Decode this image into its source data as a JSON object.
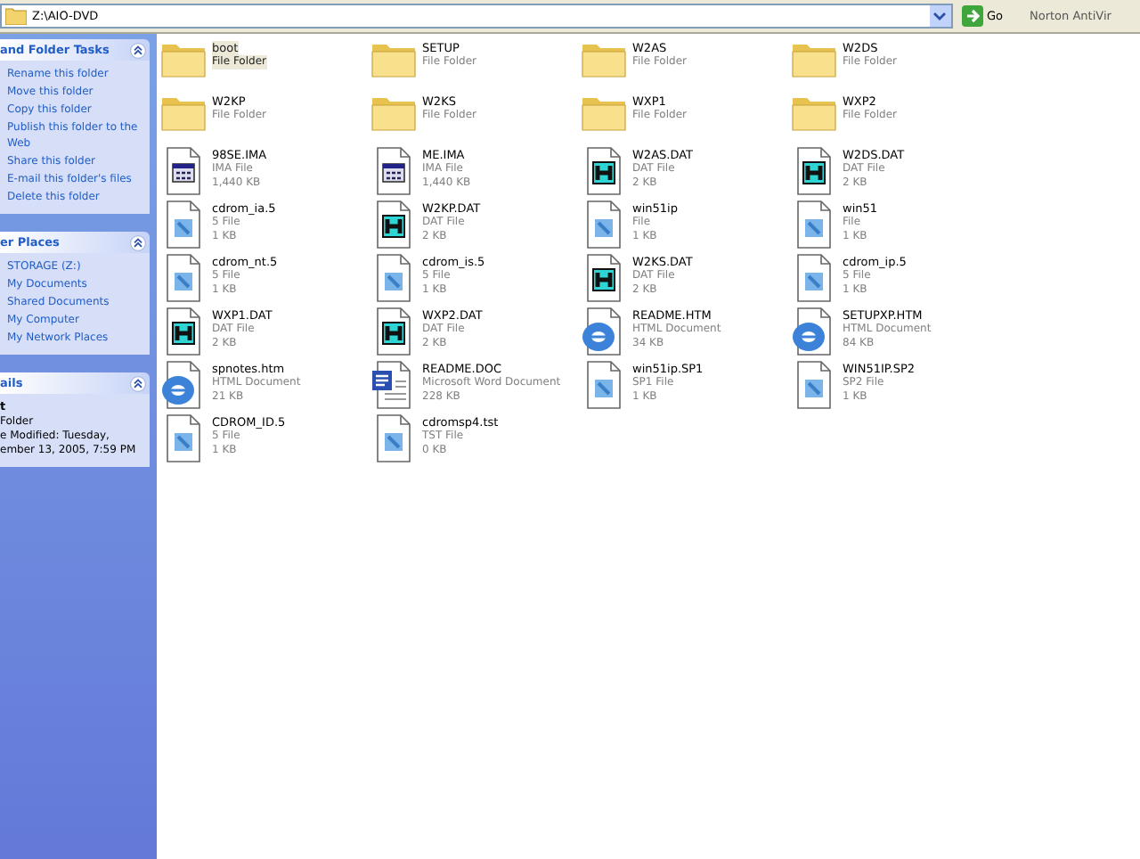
{
  "address_bar": {
    "path": "Z:\\AIO-DVD",
    "go_label": "Go",
    "toolbar_text": "Norton AntiVir"
  },
  "sidebar": {
    "panels": [
      {
        "kind": "links",
        "title": "and Folder Tasks",
        "expanded": true,
        "items": [
          "Rename this folder",
          "Move this folder",
          "Copy this folder",
          "Publish this folder to the Web",
          "Share this folder",
          "E-mail this folder's files",
          "Delete this folder"
        ]
      },
      {
        "kind": "links",
        "title": "er Places",
        "expanded": true,
        "items": [
          "STORAGE (Z:)",
          "My Documents",
          "Shared Documents",
          "My Computer",
          "My Network Places"
        ]
      },
      {
        "kind": "details",
        "title": "ails",
        "expanded": true,
        "name": "t",
        "type": "Folder",
        "modified": [
          "e Modified: Tuesday,",
          "ember 13, 2005, 7:59 PM"
        ]
      }
    ]
  },
  "files": [
    {
      "kind": "folder",
      "name": "boot",
      "type": "File Folder",
      "selected": true
    },
    {
      "kind": "folder",
      "name": "SETUP",
      "type": "File Folder",
      "selected": false
    },
    {
      "kind": "folder",
      "name": "W2AS",
      "type": "File Folder",
      "selected": false
    },
    {
      "kind": "folder",
      "name": "W2DS",
      "type": "File Folder",
      "selected": false
    },
    {
      "kind": "folder",
      "name": "W2KP",
      "type": "File Folder",
      "selected": false
    },
    {
      "kind": "folder",
      "name": "W2KS",
      "type": "File Folder",
      "selected": false
    },
    {
      "kind": "folder",
      "name": "WXP1",
      "type": "File Folder",
      "selected": false
    },
    {
      "kind": "folder",
      "name": "WXP2",
      "type": "File Folder",
      "selected": false
    },
    {
      "kind": "image",
      "name": "98SE.IMA",
      "type": "IMA File",
      "size": "1,440 KB",
      "selected": false
    },
    {
      "kind": "image",
      "name": "ME.IMA",
      "type": "IMA File",
      "size": "1,440 KB",
      "selected": false
    },
    {
      "kind": "dat",
      "name": "W2AS.DAT",
      "type": "DAT File",
      "size": "2 KB",
      "selected": false
    },
    {
      "kind": "dat",
      "name": "W2DS.DAT",
      "type": "DAT File",
      "size": "2 KB",
      "selected": false
    },
    {
      "kind": "generic",
      "name": "cdrom_ia.5",
      "type": "5 File",
      "size": "1 KB",
      "selected": false
    },
    {
      "kind": "dat",
      "name": "W2KP.DAT",
      "type": "DAT File",
      "size": "2 KB",
      "selected": false
    },
    {
      "kind": "generic",
      "name": "win51ip",
      "type": "File",
      "size": "1 KB",
      "selected": false
    },
    {
      "kind": "generic",
      "name": "win51",
      "type": "File",
      "size": "1 KB",
      "selected": false
    },
    {
      "kind": "generic",
      "name": "cdrom_nt.5",
      "type": "5 File",
      "size": "1 KB",
      "selected": false
    },
    {
      "kind": "generic",
      "name": "cdrom_is.5",
      "type": "5 File",
      "size": "1 KB",
      "selected": false
    },
    {
      "kind": "dat",
      "name": "W2KS.DAT",
      "type": "DAT File",
      "size": "2 KB",
      "selected": false
    },
    {
      "kind": "generic",
      "name": "cdrom_ip.5",
      "type": "5 File",
      "size": "1 KB",
      "selected": false
    },
    {
      "kind": "dat",
      "name": "WXP1.DAT",
      "type": "DAT File",
      "size": "2 KB",
      "selected": false
    },
    {
      "kind": "dat",
      "name": "WXP2.DAT",
      "type": "DAT File",
      "size": "2 KB",
      "selected": false
    },
    {
      "kind": "html",
      "name": "README.HTM",
      "type": "HTML Document",
      "size": "34 KB",
      "selected": false
    },
    {
      "kind": "html",
      "name": "SETUPXP.HTM",
      "type": "HTML Document",
      "size": "84 KB",
      "selected": false
    },
    {
      "kind": "html",
      "name": "spnotes.htm",
      "type": "HTML Document",
      "size": "21 KB",
      "selected": false
    },
    {
      "kind": "word",
      "name": "README.DOC",
      "type": "Microsoft Word Document",
      "size": "228 KB",
      "selected": false
    },
    {
      "kind": "generic",
      "name": "win51ip.SP1",
      "type": "SP1 File",
      "size": "1 KB",
      "selected": false
    },
    {
      "kind": "generic",
      "name": "WIN51IP.SP2",
      "type": "SP2 File",
      "size": "1 KB",
      "selected": false
    },
    {
      "kind": "generic",
      "name": "CDROM_ID.5",
      "type": "5 File",
      "size": "1 KB",
      "selected": false
    },
    {
      "kind": "generic",
      "name": "cdromsp4.tst",
      "type": "TST File",
      "size": "0 KB",
      "selected": false
    }
  ]
}
